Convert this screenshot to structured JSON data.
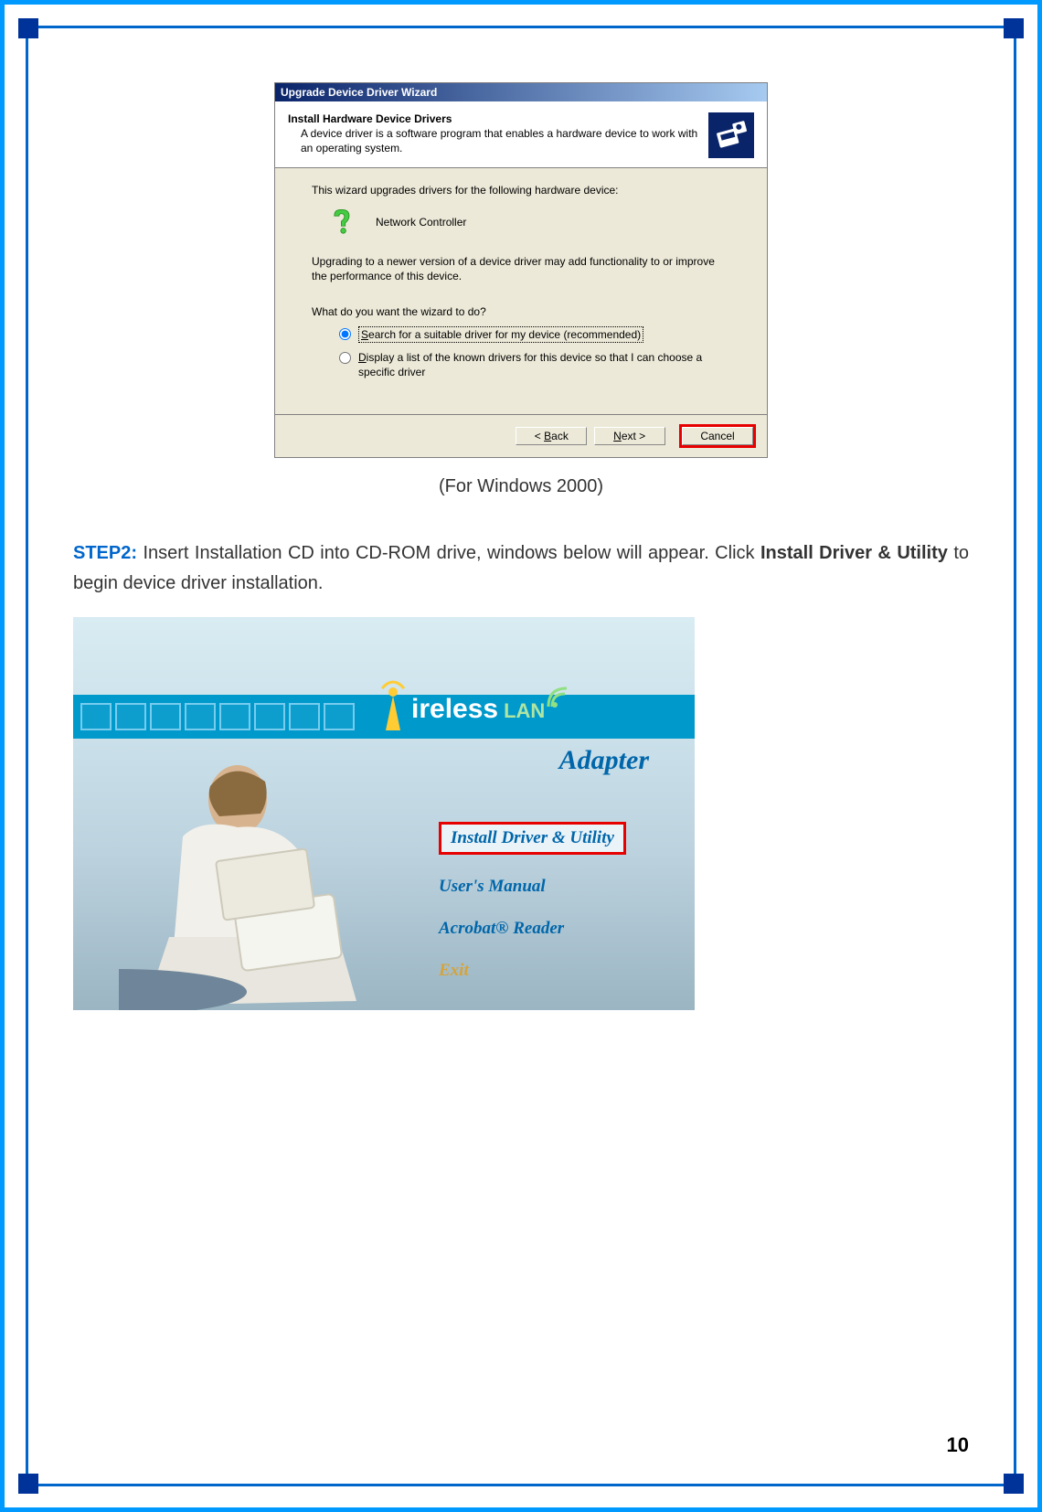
{
  "wizard": {
    "title": "Upgrade Device Driver Wizard",
    "header_title": "Install Hardware Device Drivers",
    "header_desc": "A device driver is a software program that enables a hardware device to work with an operating system.",
    "body_intro": "This wizard upgrades drivers for the following hardware device:",
    "device_name": "Network Controller",
    "body_note": "Upgrading to a newer version of a device driver may add functionality to or improve the performance of this device.",
    "question": "What do you want the wizard to do?",
    "radio1_pre": "S",
    "radio1_rest": "earch for a suitable driver for my device (recommended)",
    "radio2_pre": "D",
    "radio2_rest": "isplay a list of the known drivers for this device so that I can choose a specific driver",
    "btn_back_pre": "< ",
    "btn_back_u": "B",
    "btn_back_post": "ack",
    "btn_next_u": "N",
    "btn_next_post": "ext >",
    "btn_cancel": "Cancel"
  },
  "caption1": "(For Windows 2000)",
  "step2": {
    "label": "STEP2: ",
    "text_before_bold": "Insert Installation CD into CD-ROM drive, windows below will appear. Click ",
    "bold": "Install Driver & Utility",
    "text_after_bold": " to begin device driver installation."
  },
  "autorun": {
    "brand_text": "ireless",
    "brand_lan": "LAN",
    "subtitle": "Adapter",
    "link_install": "Install Driver & Utility",
    "link_manual": "User's  Manual",
    "link_acrobat": "Acrobat® Reader",
    "link_exit": "Exit"
  },
  "page_number": "10"
}
